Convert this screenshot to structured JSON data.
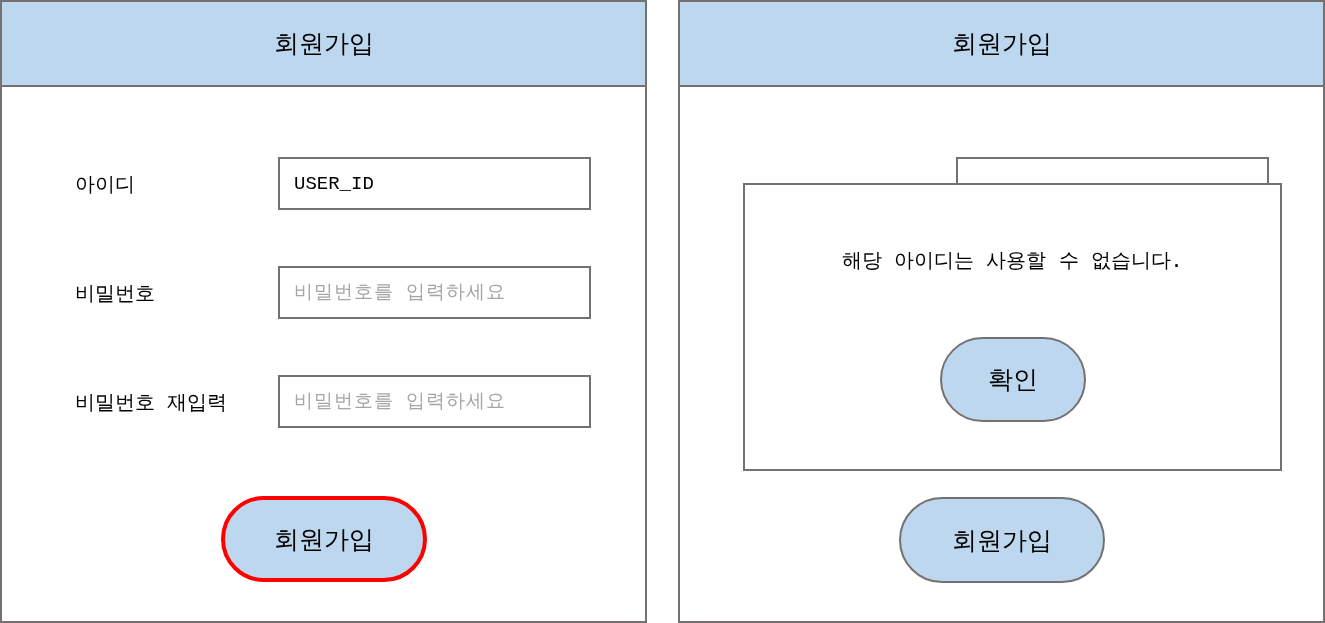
{
  "screens": [
    {
      "header": {
        "title": "회원가입"
      },
      "fields": [
        {
          "kind": "input",
          "label": "아이디",
          "value": "USER_ID"
        },
        {
          "kind": "input",
          "label": "비밀번호",
          "placeholder": "비밀번호를 입력하세요"
        },
        {
          "kind": "input",
          "label": "비밀번호 재입력",
          "placeholder": "비밀번호를 입력하세요"
        }
      ],
      "submit_button": {
        "label": "회원가입",
        "highlighted": true
      }
    },
    {
      "header": {
        "title": "회원가입"
      },
      "fields": [
        {
          "kind": "input"
        }
      ],
      "dialog": {
        "message": "해당 아이디는 사용할 수 없습니다.",
        "button": "확인"
      },
      "submit_button": {
        "label": "회원가입",
        "highlighted": false
      }
    }
  ]
}
